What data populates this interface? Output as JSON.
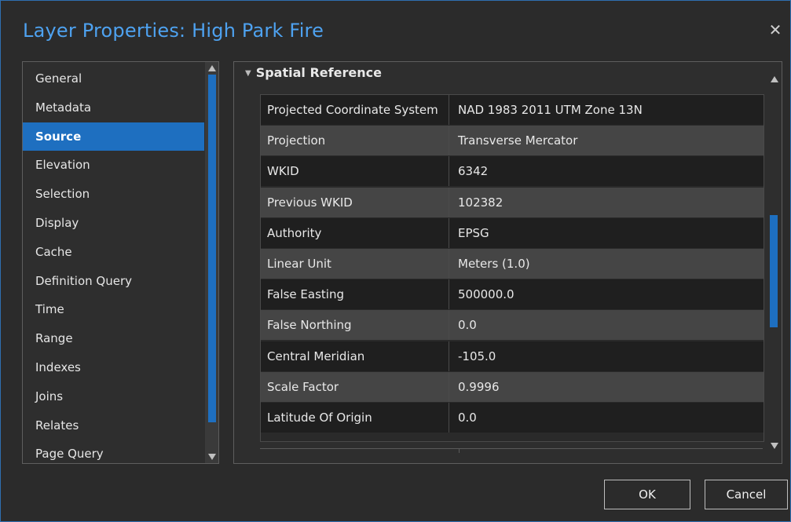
{
  "window": {
    "title": "Layer Properties: High Park Fire",
    "close_glyph": "✕"
  },
  "nav": {
    "items": [
      {
        "label": "General"
      },
      {
        "label": "Metadata"
      },
      {
        "label": "Source",
        "selected": true
      },
      {
        "label": "Elevation"
      },
      {
        "label": "Selection"
      },
      {
        "label": "Display"
      },
      {
        "label": "Cache"
      },
      {
        "label": "Definition Query"
      },
      {
        "label": "Time"
      },
      {
        "label": "Range"
      },
      {
        "label": "Indexes"
      },
      {
        "label": "Joins"
      },
      {
        "label": "Relates"
      },
      {
        "label": "Page Query"
      }
    ]
  },
  "section": {
    "header": "Spatial Reference",
    "rows": [
      {
        "name": "Projected Coordinate System",
        "value": "NAD 1983 2011 UTM Zone 13N"
      },
      {
        "name": "Projection",
        "value": "Transverse Mercator"
      },
      {
        "name": "WKID",
        "value": "6342"
      },
      {
        "name": "Previous WKID",
        "value": "102382"
      },
      {
        "name": "Authority",
        "value": "EPSG"
      },
      {
        "name": "Linear Unit",
        "value": "Meters (1.0)"
      },
      {
        "name": "False Easting",
        "value": "500000.0"
      },
      {
        "name": "False Northing",
        "value": "0.0"
      },
      {
        "name": "Central Meridian",
        "value": "-105.0"
      },
      {
        "name": "Scale Factor",
        "value": "0.9996"
      },
      {
        "name": "Latitude Of Origin",
        "value": "0.0"
      }
    ]
  },
  "buttons": {
    "ok": "OK",
    "cancel": "Cancel"
  },
  "colors": {
    "accent": "#1e6fc0",
    "title": "#4ea2f0"
  }
}
